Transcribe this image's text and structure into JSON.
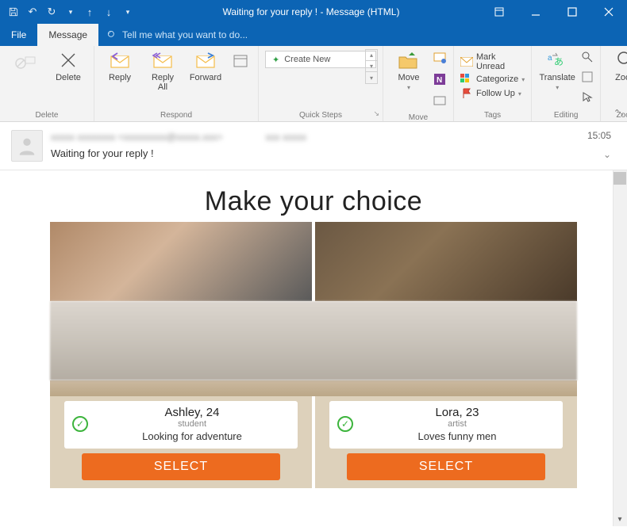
{
  "window": {
    "title": "Waiting for your reply ! - Message (HTML)"
  },
  "tabs": {
    "file": "File",
    "message": "Message",
    "tellme": "Tell me what you want to do..."
  },
  "ribbon": {
    "delete": {
      "label": "Delete",
      "group": "Delete"
    },
    "respond": {
      "reply": "Reply",
      "replyall": "Reply\nAll",
      "forward": "Forward",
      "group": "Respond"
    },
    "quicksteps": {
      "createnew": "Create New",
      "group": "Quick Steps"
    },
    "move": {
      "label": "Move",
      "group": "Move"
    },
    "tags": {
      "unread": "Mark Unread",
      "categorize": "Categorize",
      "followup": "Follow Up",
      "group": "Tags"
    },
    "editing": {
      "translate": "Translate",
      "group": "Editing"
    },
    "zoom": {
      "label": "Zoom",
      "group": "Zoom"
    }
  },
  "header": {
    "from": "xxxxx xxxxxxxx <xxxxxxxxx@xxxxx.xxx>",
    "to": "xxx xxxxx",
    "subject": "Waiting for your reply !",
    "time": "15:05"
  },
  "email": {
    "headline": "Make your choice",
    "cards": [
      {
        "name": "Ashley, 24",
        "role": "student",
        "tagline": "Looking for adventure",
        "button": "SELECT"
      },
      {
        "name": "Lora, 23",
        "role": "artist",
        "tagline": "Loves funny men",
        "button": "SELECT"
      }
    ]
  }
}
